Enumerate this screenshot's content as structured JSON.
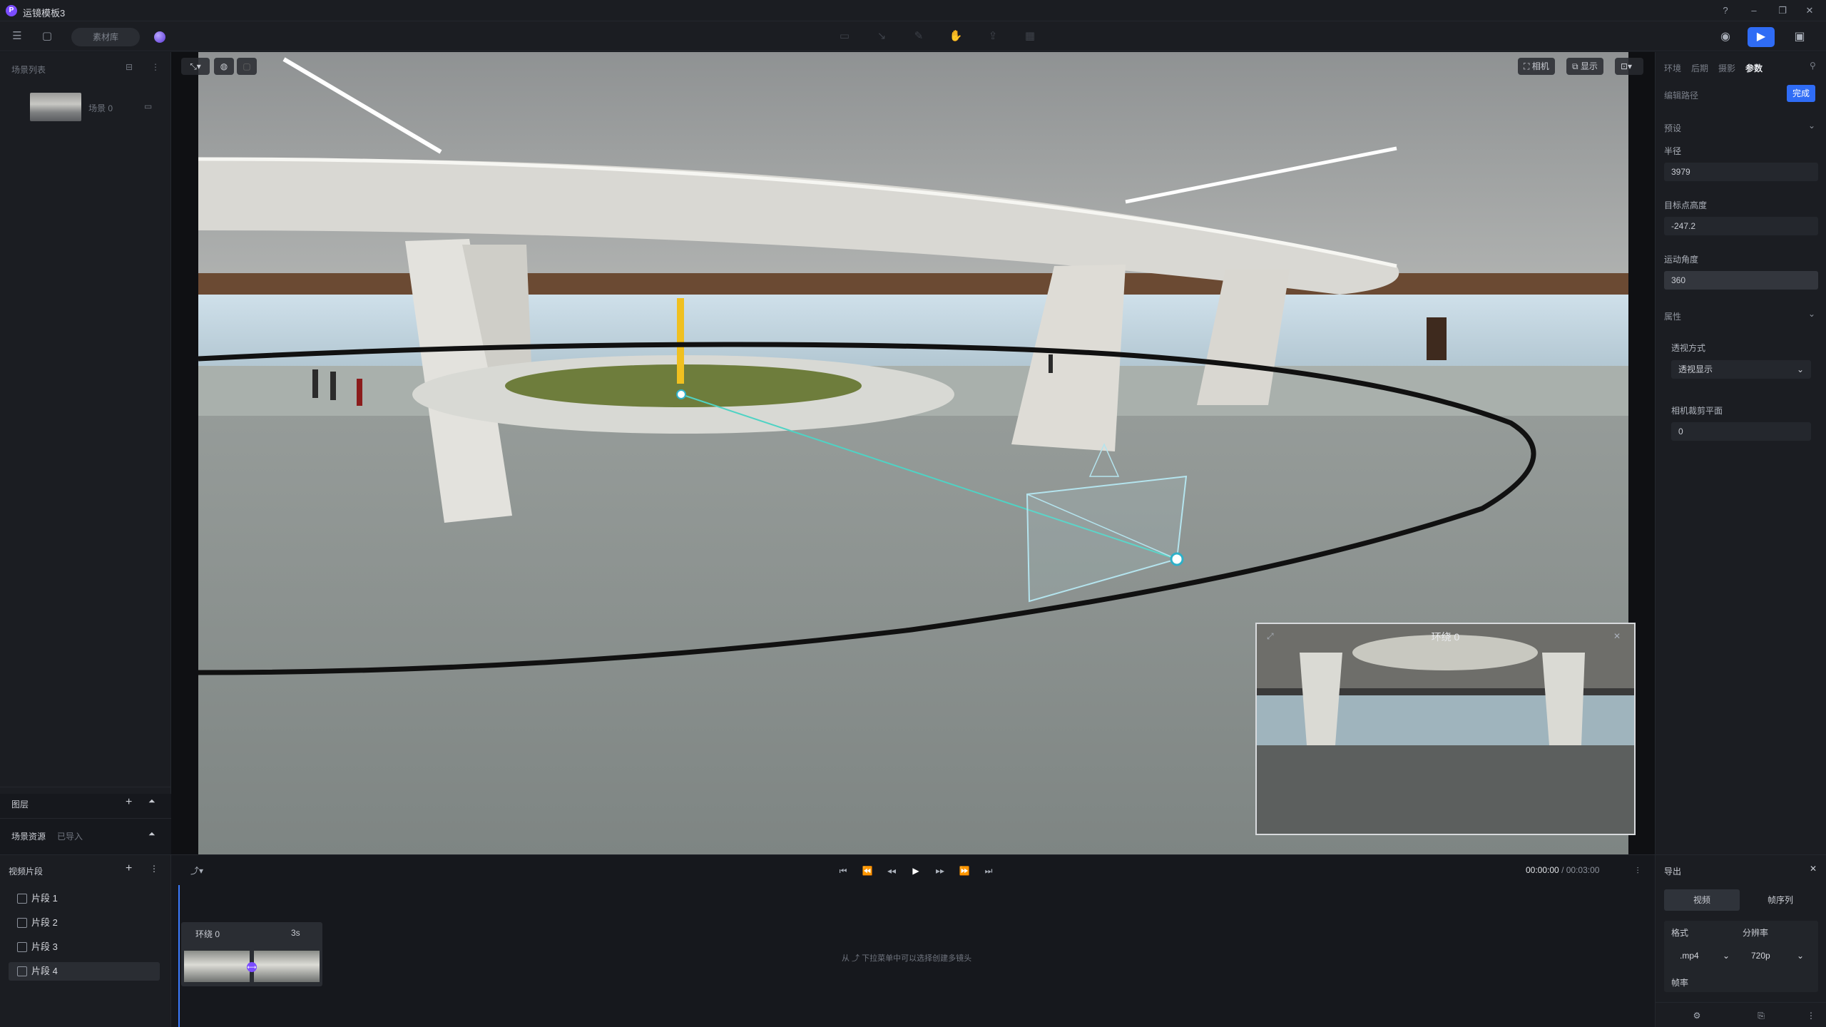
{
  "app": {
    "title": "运镜模板3"
  },
  "toolbar": {
    "asset_library": "素材库"
  },
  "left_panel": {
    "scene_list_title": "场景列表",
    "scene_item": "场景 0",
    "layers_title": "图层",
    "scene_assets_tab": "场景资源",
    "imported_tab": "已导入"
  },
  "viewport": {
    "camera_chip": "相机",
    "display_chip": "显示",
    "minimap_title": "环绕 0"
  },
  "right_panel": {
    "tabs": [
      "环境",
      "后期",
      "摄影",
      "参数"
    ],
    "edit_path_label": "编辑路径",
    "done_button": "完成",
    "preset_section": "预设",
    "radius_label": "半径",
    "radius_value": "3979",
    "target_height_label": "目标点高度",
    "target_height_value": "-247.2",
    "motion_angle_label": "运动角度",
    "motion_angle_value": "360",
    "attributes_section": "属性",
    "perspective_label": "透视方式",
    "perspective_value": "透视显示",
    "near_clip_label": "相机裁剪平面",
    "near_clip_value": "0"
  },
  "timeline": {
    "video_clips_title": "视频片段",
    "clips": [
      "片段 1",
      "片段 2",
      "片段 3",
      "片段 4"
    ],
    "timecode_current": "00:00:00",
    "timecode_total": "/ 00:03:00",
    "track_clip_name": "环绕 0",
    "track_clip_duration": "3s",
    "hint": "从 ⤴ 下拉菜单中可以选择创建多镜头"
  },
  "export": {
    "title": "导出",
    "tab_video": "视频",
    "tab_frames": "帧序列",
    "format_label": "格式",
    "resolution_label": "分辨率",
    "format_value": ".mp4",
    "resolution_value": "720p",
    "framerate_label": "帧率"
  }
}
